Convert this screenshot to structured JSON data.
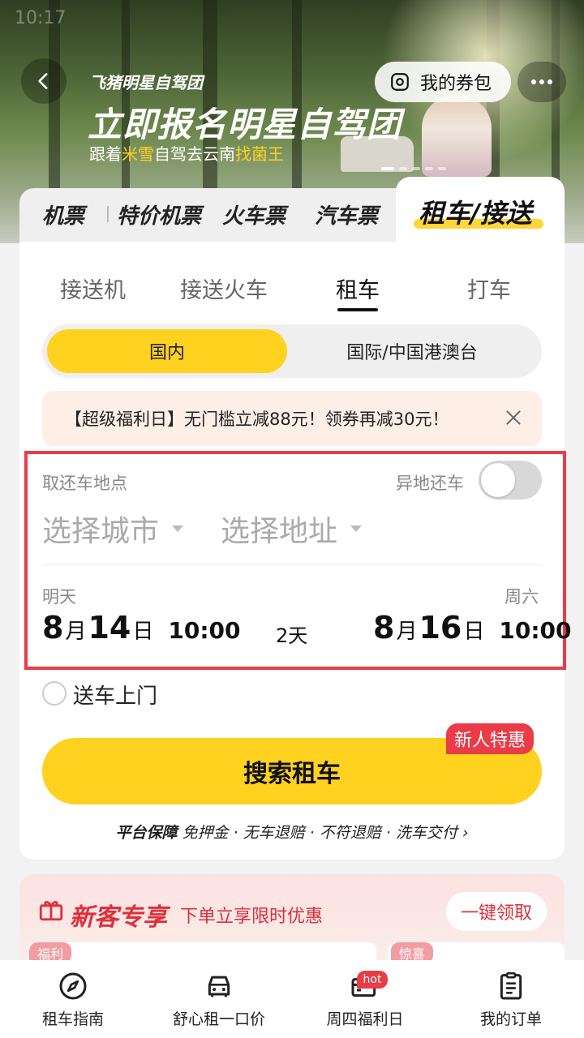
{
  "banner": {
    "status_time": "10:17",
    "brand": "飞猪明星自驾团",
    "headline": "立即报名明星自驾团",
    "sub_prefix": "跟着",
    "sub_hl1": "米雪",
    "sub_mid": "自驾去云南",
    "sub_hl2": "找菌王",
    "coupon_label": "我的券包"
  },
  "top_tabs": [
    {
      "label": "机票"
    },
    {
      "label": "特价机票"
    },
    {
      "label": "火车票"
    },
    {
      "label": "汽车票"
    }
  ],
  "top_tab_active": "租车/接送",
  "sub_tabs": [
    {
      "label": "接送机"
    },
    {
      "label": "接送火车"
    },
    {
      "label": "租车"
    },
    {
      "label": "打车"
    }
  ],
  "region": {
    "domestic": "国内",
    "intl": "国际/中国港澳台"
  },
  "promo_text": "【超级福利日】无门槛立减88元！领券再减30元！",
  "location": {
    "label": "取还车地点",
    "diff_return": "异地还车",
    "city_placeholder": "选择城市",
    "address_placeholder": "选择地址"
  },
  "dates": {
    "pickup_day": "明天",
    "pickup_month": "8",
    "pickup_date": "14",
    "pickup_time": "10:00",
    "duration": "2天",
    "return_day": "周六",
    "return_month": "8",
    "return_date": "16",
    "return_time": "10:00",
    "month_unit": "月",
    "day_unit": "日"
  },
  "delivery_label": "送车上门",
  "search_label": "搜索租车",
  "new_user_badge": "新人特惠",
  "guarantee": {
    "bold": "平台保障",
    "items": "免押金 · 无车退赔 · 不符退赔 · 洗车交付",
    "arrow": "›"
  },
  "new_customer": {
    "title": "新客专享",
    "subtitle": "下单立享限时优惠",
    "button": "一键领取",
    "tag1": "福利",
    "tag2": "惊喜"
  },
  "bottom_nav": [
    {
      "label": "租车指南"
    },
    {
      "label": "舒心租一口价"
    },
    {
      "label": "周四福利日"
    },
    {
      "label": "我的订单"
    }
  ],
  "hot_badge": "hot",
  "colors": {
    "accent": "#ffd21f",
    "red": "#ea3b48"
  }
}
